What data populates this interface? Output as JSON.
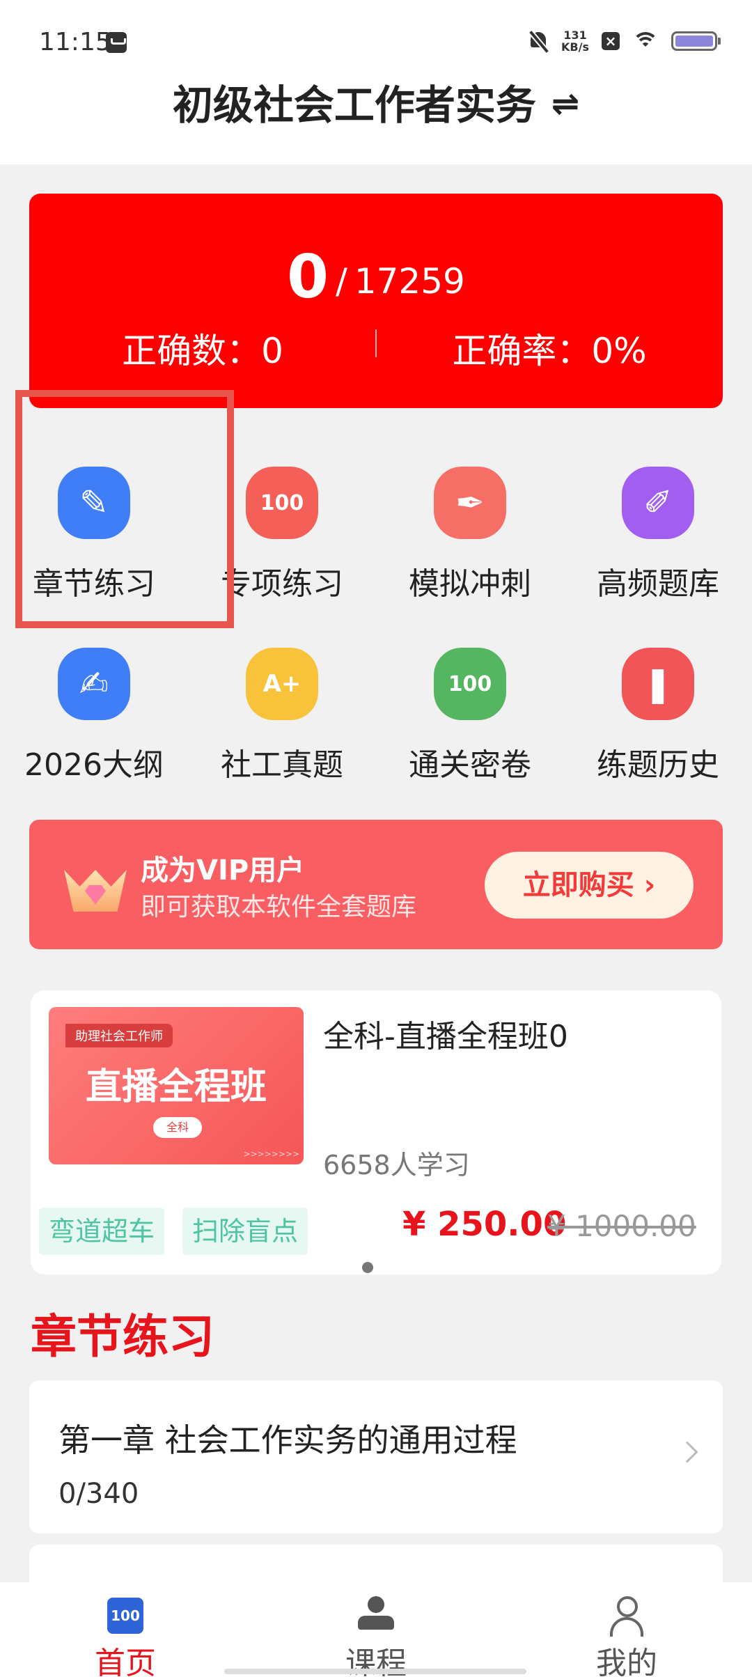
{
  "status_bar": {
    "time": "11:15",
    "net_speed_value": "131",
    "net_speed_unit": "KB/s"
  },
  "header": {
    "title": "初级社会工作者实务",
    "swap_glyph": "⇌"
  },
  "score": {
    "answered": "0",
    "separator": "/",
    "total": "17259",
    "correct_count_label": "正确数：0",
    "correct_rate_label": "正确率：0%"
  },
  "features": [
    {
      "label": "章节练习",
      "icon": "pencil-icon",
      "color": "#3f7ef7"
    },
    {
      "label": "专项练习",
      "icon": "score-100-icon",
      "color": "#f45f58"
    },
    {
      "label": "模拟冲刺",
      "icon": "pen-nib-icon",
      "color": "#f66f67"
    },
    {
      "label": "高频题库",
      "icon": "pencil-cross-icon",
      "color": "#a25ef0"
    },
    {
      "label": "2026大纲",
      "icon": "document-edit-icon",
      "color": "#3f7ef7"
    },
    {
      "label": "社工真题",
      "icon": "exam-paper-icon",
      "color": "#f8c33b"
    },
    {
      "label": "通关密卷",
      "icon": "score-100-icon",
      "color": "#55b661"
    },
    {
      "label": "练题历史",
      "icon": "history-note-icon",
      "color": "#f25558"
    }
  ],
  "feature_glyphs": [
    "✎",
    "100",
    "✒",
    "✐",
    "✍",
    "A+",
    "100",
    "❚"
  ],
  "vip": {
    "title": "成为VIP用户",
    "subtitle": "即可获取本软件全套题库",
    "button": "立即购买 ›"
  },
  "course": {
    "thumb_tag": "助理社会工作师",
    "thumb_title": "直播全程班",
    "thumb_pill": "全科",
    "thumb_arrows": ">>>>>>>>",
    "title": "全科-直播全程班0",
    "learners": "6658人学习",
    "tags": [
      "弯道超车",
      "扫除盲点"
    ],
    "price_current": "¥ 250.00",
    "price_original": "¥ 1000.00"
  },
  "section": {
    "title": "章节练习"
  },
  "chapters": [
    {
      "title": "第一章 社会工作实务的通用过程",
      "progress": "0/340"
    }
  ],
  "bottom_nav": [
    {
      "label": "首页",
      "active": true,
      "icon": "home-100-icon"
    },
    {
      "label": "课程",
      "active": false,
      "icon": "teacher-icon"
    },
    {
      "label": "我的",
      "active": false,
      "icon": "user-icon"
    }
  ],
  "home_icon_text": "100"
}
